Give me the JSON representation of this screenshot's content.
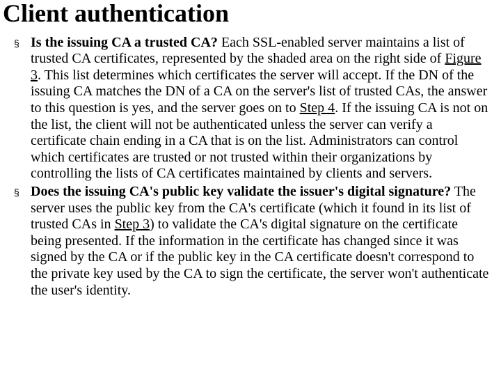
{
  "heading": "Client authentication",
  "items": [
    {
      "lead": "Is the issuing CA a trusted CA?",
      "segments": [
        {
          "t": "text",
          "v": " Each SSL-enabled server maintains a list of trusted CA certificates, represented by the shaded area on the right side of "
        },
        {
          "t": "link",
          "v": "Figure 3"
        },
        {
          "t": "text",
          "v": ". This list determines which certificates the server will accept. If the DN of the issuing CA matches the DN of a CA on the server's list of trusted CAs, the answer to this question is yes, and the server goes on to "
        },
        {
          "t": "link",
          "v": "Step 4"
        },
        {
          "t": "text",
          "v": ". If the issuing CA is not on the list, the client will not be authenticated unless the server can verify a certificate chain ending in a CA that is on the list. Administrators can control which certificates are trusted or not trusted within their organizations by controlling the lists of CA certificates maintained by clients and servers."
        }
      ]
    },
    {
      "lead": "Does the issuing CA's public key validate the issuer's digital signature?",
      "segments": [
        {
          "t": "text",
          "v": " The server uses the public key from the CA's certificate (which it found in its list of trusted CAs in "
        },
        {
          "t": "link",
          "v": "Step 3"
        },
        {
          "t": "text",
          "v": ") to validate the CA's digital signature on the certificate being presented. If the information in the certificate has changed since it was signed by the CA or if the public key in the CA certificate doesn't correspond to the private key used by the CA to sign the certificate, the server won't authenticate the user's identity."
        }
      ]
    }
  ]
}
